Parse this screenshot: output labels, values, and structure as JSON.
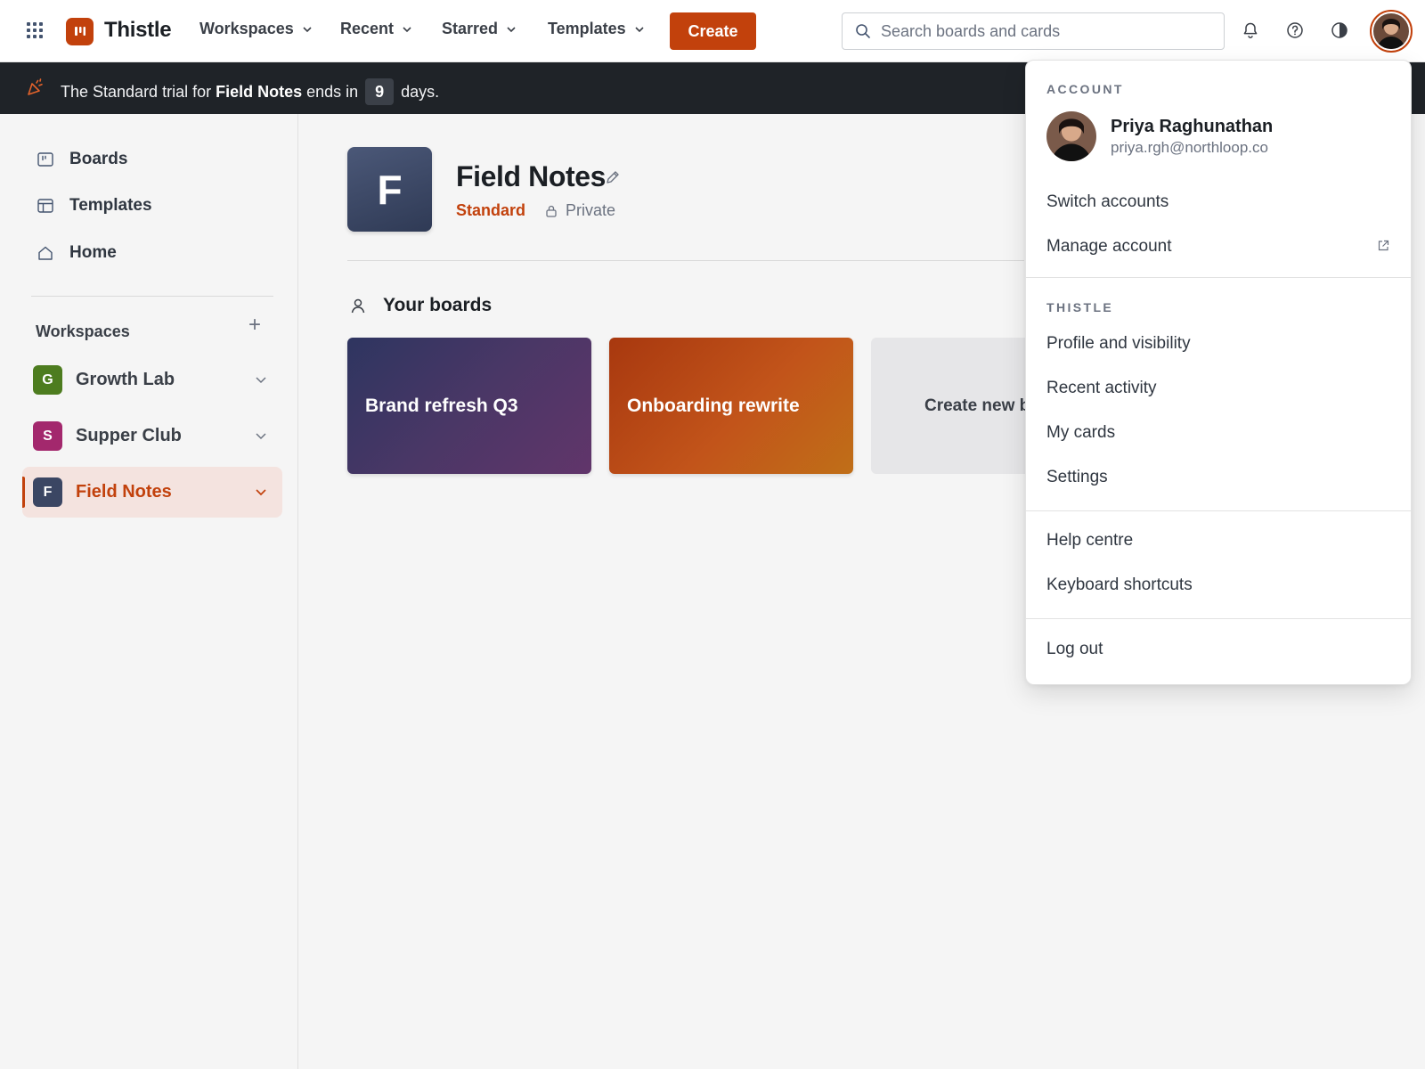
{
  "app": {
    "name": "Thistle"
  },
  "topbar": {
    "nav": [
      {
        "label": "Workspaces"
      },
      {
        "label": "Recent"
      },
      {
        "label": "Starred"
      },
      {
        "label": "Templates"
      }
    ],
    "create_label": "Create",
    "search_placeholder": "Search boards and cards",
    "icons": [
      "bell-icon",
      "help-icon",
      "contrast-icon"
    ]
  },
  "banner": {
    "prefix": "The Standard trial for",
    "workspace": "Field Notes",
    "middle": "ends in",
    "days": "9",
    "suffix": "days."
  },
  "sidebar": {
    "links": [
      {
        "label": "Boards",
        "icon": "board-icon"
      },
      {
        "label": "Templates",
        "icon": "template-icon"
      },
      {
        "label": "Home",
        "icon": "home-icon"
      }
    ],
    "workspaces_heading": "Workspaces",
    "add_symbol": "+",
    "workspaces": [
      {
        "initial": "G",
        "name": "Growth Lab",
        "color": "#4d7c1f",
        "active": false
      },
      {
        "initial": "S",
        "name": "Supper Club",
        "color": "#a3286d",
        "active": false
      },
      {
        "initial": "F",
        "name": "Field Notes",
        "color": "#3b4663",
        "active": true
      }
    ]
  },
  "main": {
    "workspace_initial": "F",
    "workspace_title": "Field Notes",
    "plan": "Standard",
    "privacy": "Private",
    "boards_heading": "Your boards",
    "boards": [
      {
        "title": "Brand refresh Q3"
      },
      {
        "title": "Onboarding rewrite"
      }
    ],
    "create_board_label": "Create new b"
  },
  "account_menu": {
    "account_heading": "ACCOUNT",
    "user_name": "Priya Raghunathan",
    "user_email": "priya.rgh@northloop.co",
    "switch_accounts": "Switch accounts",
    "manage_account": "Manage account",
    "app_heading": "THISTLE",
    "app_items": [
      "Profile and visibility",
      "Recent activity",
      "My cards",
      "Settings"
    ],
    "help_items": [
      "Help centre",
      "Keyboard shortcuts"
    ],
    "logout": "Log out"
  },
  "colors": {
    "accent": "#c2410c",
    "banner_bg": "#1f2328",
    "active_row_bg": "#f4e3df"
  }
}
